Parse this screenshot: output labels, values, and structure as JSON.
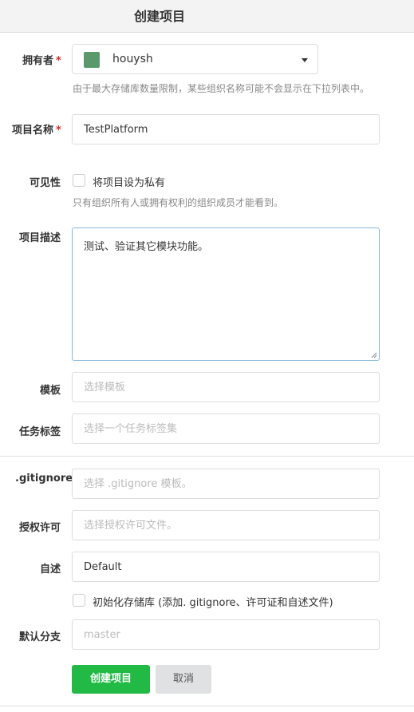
{
  "page_title": "创建项目",
  "owner": {
    "label": "拥有者",
    "required_mark": "*",
    "selected": "houysh",
    "help": "由于最大存储库数量限制，某些组织名称可能不会显示在下拉列表中。"
  },
  "repo_name": {
    "label": "项目名称",
    "required_mark": "*",
    "value": "TestPlatform"
  },
  "visibility": {
    "label": "可见性",
    "checkbox_label": "将项目设为私有",
    "help": "只有组织所有人或拥有权利的组织成员才能看到。"
  },
  "description": {
    "label": "项目描述",
    "value": "测试、验证其它模块功能。"
  },
  "template": {
    "label": "模板",
    "placeholder": "选择模板"
  },
  "issue_labels": {
    "label": "任务标签",
    "placeholder": "选择一个任务标签集"
  },
  "gitignore": {
    "label": ".gitignore",
    "placeholder": "选择 .gitignore 模板。"
  },
  "license": {
    "label": "授权许可",
    "placeholder": "选择授权许可文件。"
  },
  "readme": {
    "label": "自述",
    "value": "Default"
  },
  "auto_init": {
    "checkbox_label": "初始化存储库 (添加. gitignore、许可证和自述文件)"
  },
  "default_branch": {
    "label": "默认分支",
    "placeholder": "master"
  },
  "buttons": {
    "create": "创建项目",
    "cancel": "取消"
  },
  "colors": {
    "primary": "#21ba45",
    "required": "#db2828",
    "avatar": "#5a9a6a"
  }
}
